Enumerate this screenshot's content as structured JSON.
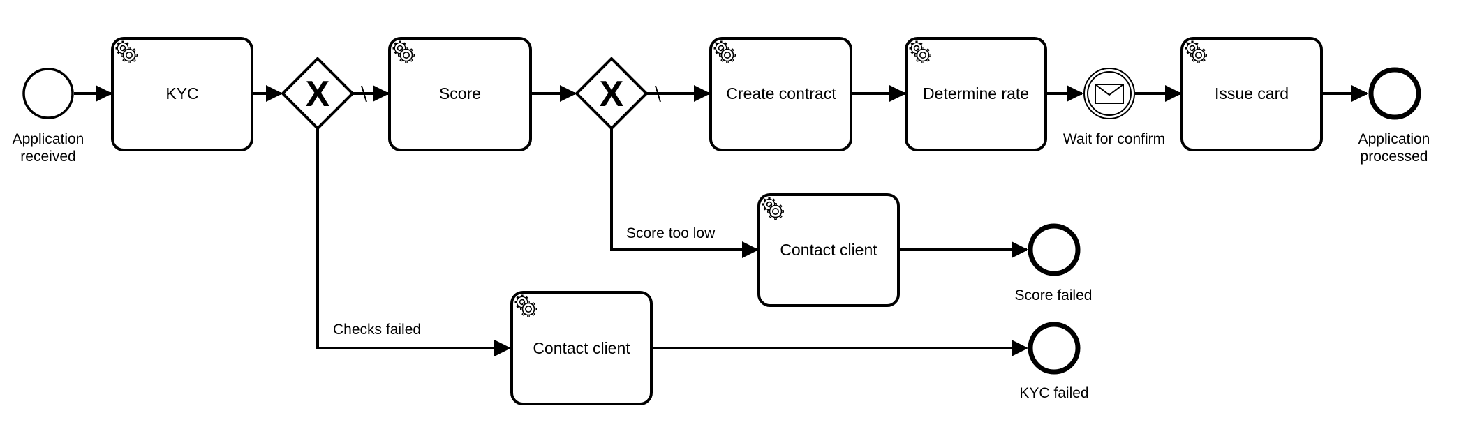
{
  "diagram": {
    "type": "BPMN process",
    "events": {
      "start": {
        "label_lines": [
          "Application",
          "received"
        ],
        "icon": "start-event-circle"
      },
      "wait_confirm": {
        "label_lines": [
          "Wait for confirm"
        ],
        "icon": "message-envelope-icon"
      },
      "end_processed": {
        "label_lines": [
          "Application",
          "processed"
        ],
        "icon": "end-event-circle"
      },
      "end_score_failed": {
        "label_lines": [
          "Score failed"
        ],
        "icon": "end-event-circle"
      },
      "end_kyc_failed": {
        "label_lines": [
          "KYC failed"
        ],
        "icon": "end-event-circle"
      }
    },
    "tasks": {
      "kyc": {
        "label": "KYC",
        "icon": "service-task-gear-icon"
      },
      "score": {
        "label": "Score",
        "icon": "service-task-gear-icon"
      },
      "create_contract": {
        "label": "Create contract",
        "icon": "service-task-gear-icon"
      },
      "determine_rate": {
        "label": "Determine rate",
        "icon": "service-task-gear-icon"
      },
      "issue_card": {
        "label": "Issue card",
        "icon": "service-task-gear-icon"
      },
      "contact_client_score": {
        "label": "Contact client",
        "icon": "service-task-gear-icon"
      },
      "contact_client_kyc": {
        "label": "Contact client",
        "icon": "service-task-gear-icon"
      }
    },
    "gateways": {
      "kyc_check": {
        "type": "exclusive",
        "marker": "X"
      },
      "score_check": {
        "type": "exclusive",
        "marker": "X"
      }
    },
    "flows": {
      "checks_failed": {
        "label": "Checks failed"
      },
      "score_too_low": {
        "label": "Score too low"
      }
    },
    "colors": {
      "stroke": "#000000",
      "fill": "#ffffff"
    }
  }
}
